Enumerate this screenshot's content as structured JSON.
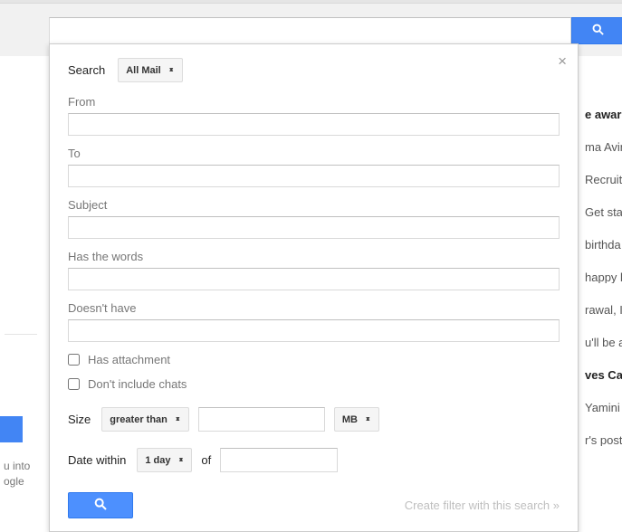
{
  "scope_row": {
    "label": "Search",
    "selected": "All Mail"
  },
  "fields": {
    "from": {
      "label": "From",
      "value": ""
    },
    "to": {
      "label": "To",
      "value": ""
    },
    "subject": {
      "label": "Subject",
      "value": ""
    },
    "has_words": {
      "label": "Has the words",
      "value": ""
    },
    "doesnt_have": {
      "label": "Doesn't have",
      "value": ""
    }
  },
  "checks": {
    "has_attachment": "Has attachment",
    "no_chats": "Don't include chats"
  },
  "size": {
    "label": "Size",
    "op": "greater than",
    "value": "",
    "unit": "MB"
  },
  "date": {
    "label": "Date within",
    "range": "1 day",
    "of": "of",
    "value": ""
  },
  "actions": {
    "create_filter": "Create filter with this search »"
  },
  "left_peek": {
    "l1": "u into",
    "l2": "ogle"
  },
  "bg_rows": [
    {
      "text": "e aware",
      "bold": true
    },
    {
      "text": "ma Avin"
    },
    {
      "text": "Recruit"
    },
    {
      "text": "Get sta"
    },
    {
      "text": "birthda"
    },
    {
      "text": "happy b"
    },
    {
      "text": "rawal, I"
    },
    {
      "text": "u'll be a"
    },
    {
      "text": "ves Car",
      "bold": true
    },
    {
      "text": "Yamini I"
    },
    {
      "text": "r's post"
    }
  ]
}
